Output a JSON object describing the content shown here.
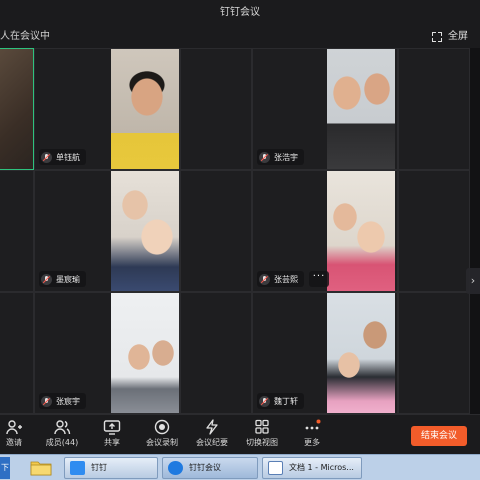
{
  "window": {
    "title": "钉钉会议"
  },
  "header": {
    "participants_text": "人在会议中",
    "fullscreen_label": "全屏"
  },
  "tiles": [
    {
      "name": "",
      "active": true
    },
    {
      "name": "单钰航"
    },
    {
      "name": ""
    },
    {
      "name": "张浩宇"
    },
    {
      "name": ""
    },
    {
      "name": "墨宸瑜"
    },
    {
      "name": ""
    },
    {
      "name": "张芸熙"
    },
    {
      "name": ""
    },
    {
      "name": "张宸宇"
    },
    {
      "name": ""
    },
    {
      "name": "魏丁轩"
    }
  ],
  "toolbar": {
    "invite": "邀请",
    "members": "成员(44)",
    "share": "共享",
    "record": "会议录制",
    "minutes": "会议纪要",
    "layout": "切换视图",
    "more": "更多",
    "end": "结束会议"
  },
  "taskbar": {
    "start": "下",
    "items": [
      "钉钉",
      "钉钉会议",
      "文档 1 - Micros..."
    ]
  },
  "colors": {
    "accent_green": "#2ec27e",
    "end_button": "#f25c2a",
    "taskbar": "#bcd0e8"
  }
}
